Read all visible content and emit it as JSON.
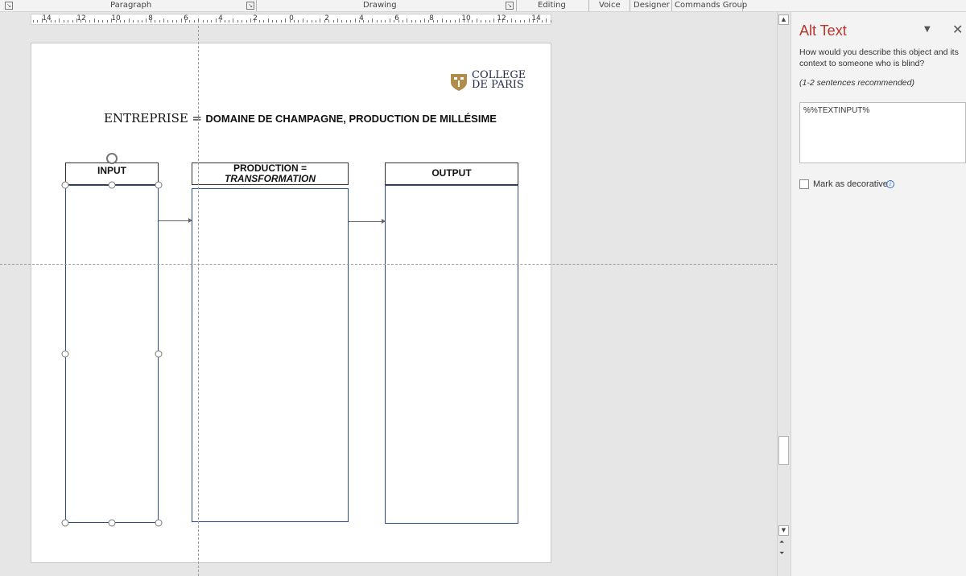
{
  "ribbon": {
    "groups": [
      "Paragraph",
      "Drawing",
      "Editing",
      "Voice",
      "Designer",
      "Commands Group"
    ]
  },
  "ruler": {
    "labels": [
      "14",
      "12",
      "10",
      "8",
      "6",
      "4",
      "2",
      "0",
      "2",
      "4",
      "6",
      "8",
      "10",
      "12",
      "14"
    ]
  },
  "slide": {
    "logo": {
      "line1": "COLLEGE",
      "line2": "DE PARIS"
    },
    "title": {
      "prefix": "ENTREPRISE",
      "equals": "=",
      "rest": "DOMAINE DE CHAMPAGNE, PRODUCTION DE MILLÉSIME"
    },
    "columns": {
      "input": "INPUT",
      "production_line1": "PRODUCTION =",
      "production_line2": "TRANSFORMATION",
      "output": "OUTPUT"
    }
  },
  "pane": {
    "title": "Alt Text",
    "question": "How would you describe this object and its context to someone who is blind?",
    "hint": "(1-2 sentences recommended)",
    "input_value": "%%TEXTINPUT%",
    "decorative_label": "Mark as decorative"
  },
  "colors": {
    "accent": "#b5362c",
    "box_border": "#2e4a8b",
    "logo_gold": "#b08d4a"
  }
}
